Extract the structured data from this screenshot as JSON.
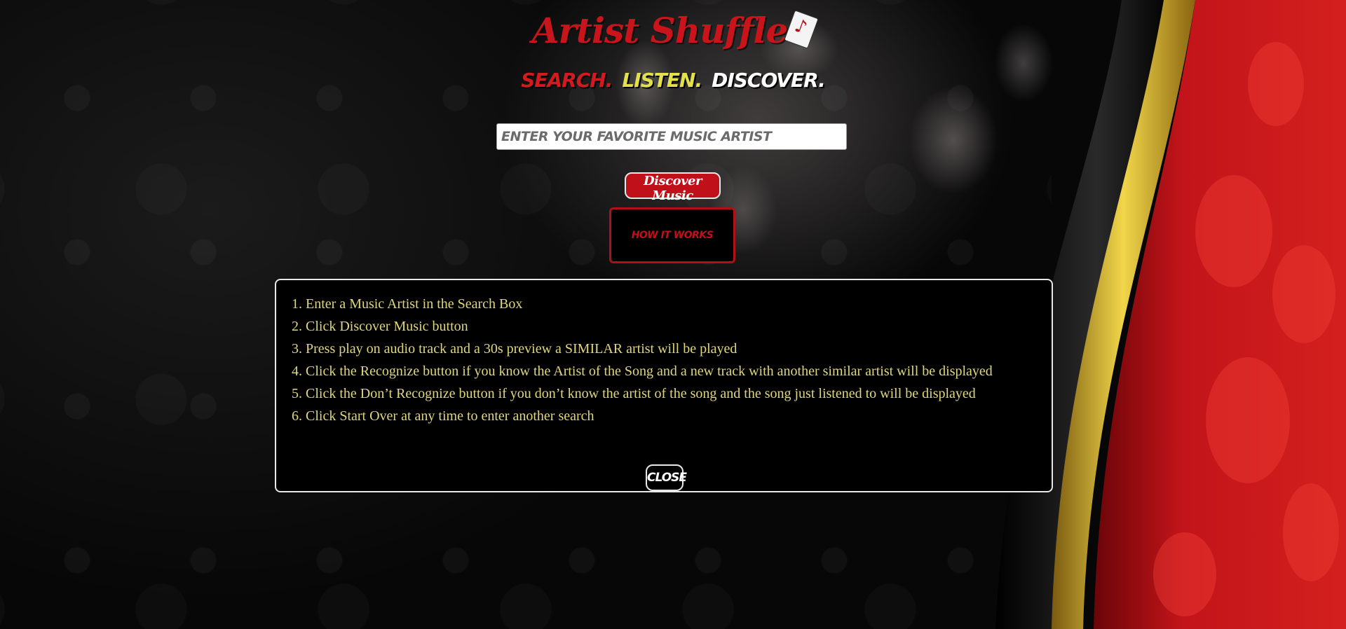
{
  "header": {
    "title": "Artist Shuffle",
    "note_symbol": "♪",
    "tagline": {
      "search": "SEARCH.",
      "listen": "LISTEN.",
      "discover": "DISCOVER."
    }
  },
  "search": {
    "placeholder": "ENTER YOUR FAVORITE MUSIC ARTIST",
    "value": ""
  },
  "buttons": {
    "discover_label": "Discover Music",
    "how_it_works_label": "HOW IT WORKS",
    "close_label": "CLOSE"
  },
  "instructions": [
    "Enter a Music Artist in the Search Box",
    "Click Discover Music button",
    "Press play on audio track and a 30s preview a SIMILAR artist will be played",
    "Click the Recognize button if you know the Artist of the Song and a new track with another similar artist will be displayed",
    "Click the Don’t Recognize button if you don’t know the artist of the song and the song just listened to will be displayed",
    "Click Start Over at any time to enter another search"
  ],
  "colors": {
    "brand_red": "#c0101a",
    "listen_yellow": "#e3e04a",
    "instruction_text": "#e0d77a",
    "gold": "#d9b53a"
  }
}
